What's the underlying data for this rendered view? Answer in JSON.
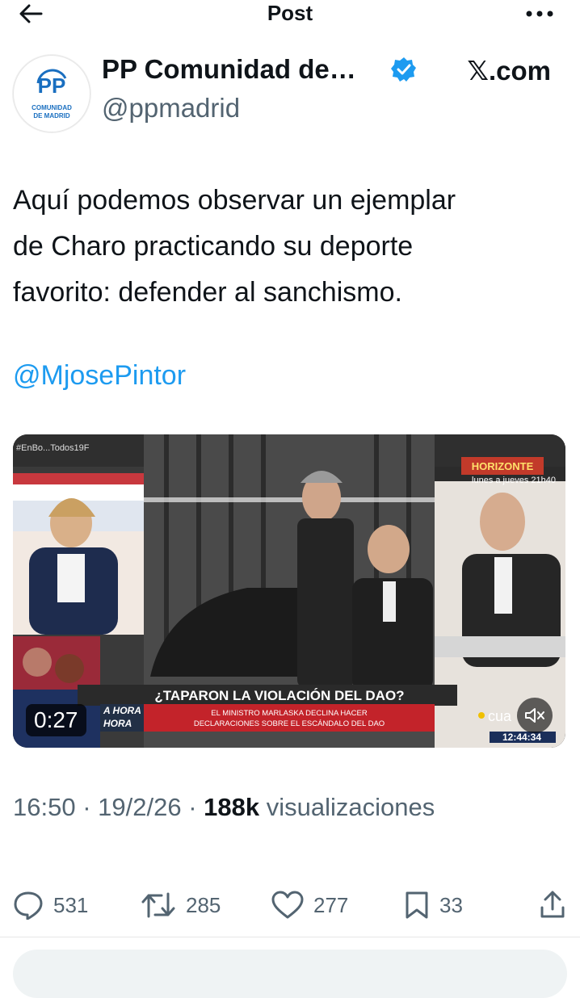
{
  "header": {
    "title": "Post"
  },
  "tweet": {
    "author_name": "PP Comunidad de…",
    "handle": "@ppmadrid",
    "source": "𝕏.com",
    "avatar": {
      "logo_text": "PP",
      "sub_line1": "COMUNIDAD",
      "sub_line2": "DE MADRID"
    },
    "text": "Aquí podemos observar un ejemplar\nde Charo practicando su deporte\nfavorito: defender al sanchismo.",
    "mention": "@MjosePintor",
    "media": {
      "duration": "0:27",
      "overlay_tag": "#EnBo...Todos19F",
      "headline": "¿TAPARON LA VIOLACIÓN DEL DAO?",
      "subline1": "EL MINISTRO MARLASKA DECLINA HACER",
      "subline2": "DECLARACIONES SOBRE EL ESCÁNDALO DEL DAO",
      "show_name": "HORIZONTE",
      "schedule": "lunes a jueves 21h40",
      "clock": "12:44:34",
      "channel": "cua",
      "ticker_left": "A HORA",
      "ticker_left2": "HORA"
    },
    "time": "16:50",
    "date": "19/2/26",
    "views_count": "188k",
    "views_label": "visualizaciones",
    "stats": {
      "replies": "531",
      "reposts": "285",
      "likes": "277",
      "bookmarks": "33"
    }
  },
  "colors": {
    "accent": "#1d9bf0",
    "muted": "#536471",
    "text": "#0f1419",
    "pp_blue": "#1a6fc0"
  }
}
